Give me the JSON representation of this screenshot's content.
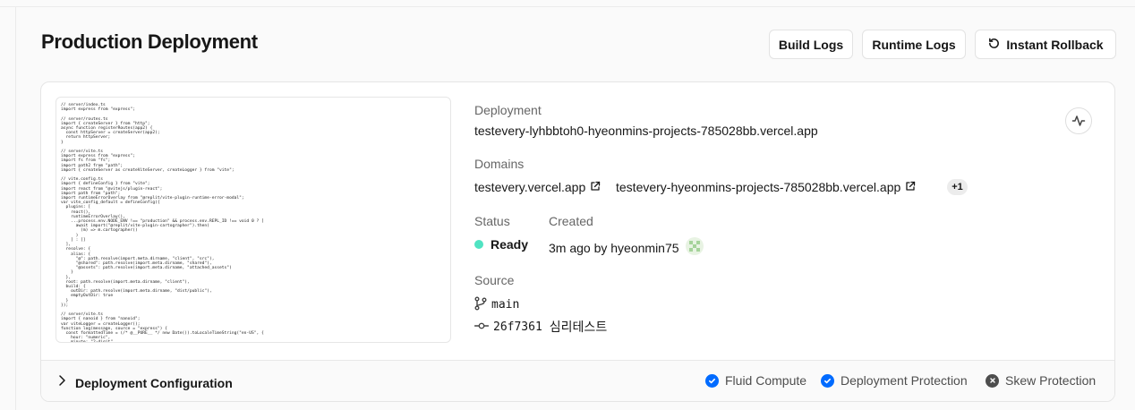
{
  "header": {
    "title": "Production Deployment",
    "buttons": {
      "build_logs": "Build Logs",
      "runtime_logs": "Runtime Logs",
      "instant_rollback": "Instant Rollback"
    }
  },
  "preview": {
    "code": "// server/index.ts\nimport express from \"express\";\n\n// server/routes.ts\nimport { createServer } from \"http\";\nasync function registerRoutes(app2) {\n  const httpServer = createServer(app2);\n  return httpServer;\n}\n\n// server/vite.ts\nimport express from \"express\";\nimport fs from \"fs\";\nimport path2 from \"path\";\nimport { createServer as createViteServer, createLogger } from \"vite\";\n\n// vite.config.ts\nimport { defineConfig } from \"vite\";\nimport react from \"@vitejs/plugin-react\";\nimport path from \"path\";\nimport runtimeErrorOverlay from \"@replit/vite-plugin-runtime-error-modal\";\nvar vite_config_default = defineConfig({\n  plugins: [\n    react(),\n    runtimeErrorOverlay(),\n    ...process.env.NODE_ENV !== \"production\" && process.env.REPL_ID !== void 0 ? [\n      await import(\"@replit/vite-plugin-cartographer\").then(\n        (m) => m.cartographer()\n      )\n    ] : []\n  ],\n  resolve: {\n    alias: {\n      \"@\": path.resolve(import.meta.dirname, \"client\", \"src\"),\n      \"@shared\": path.resolve(import.meta.dirname, \"shared\"),\n      \"@assets\": path.resolve(import.meta.dirname, \"attached_assets\")\n    }\n  },\n  root: path.resolve(import.meta.dirname, \"client\"),\n  build: {\n    outDir: path.resolve(import.meta.dirname, \"dist/public\"),\n    emptyOutDir: true\n  }\n});\n\n// server/vite.ts\nimport { nanoid } from \"nanoid\";\nvar viteLogger = createLogger();\nfunction log(message, source = \"express\") {\n  const formattedTime = (/* @__PURE__ */ new Date()).toLocaleTimeString(\"en-US\", {\n    hour: \"numeric\",\n    minute: \"2-digit\",\n    second: \"2-digit\","
  },
  "deployment": {
    "label": "Deployment",
    "url": "testevery-lyhbbtoh0-hyeonmins-projects-785028bb.vercel.app"
  },
  "domains": {
    "label": "Domains",
    "items": [
      "testevery.vercel.app",
      "testevery-hyeonmins-projects-785028bb.vercel.app"
    ],
    "extra_count": "+1"
  },
  "status": {
    "label": "Status",
    "value": "Ready",
    "color": "#50e3c2"
  },
  "created": {
    "label": "Created",
    "value": "3m ago by hyeonmin75"
  },
  "source": {
    "label": "Source",
    "branch": "main",
    "commit_hash": "26f7361",
    "commit_message": "심리테스트"
  },
  "footer": {
    "config_label": "Deployment Configuration",
    "features": [
      {
        "label": "Fluid Compute",
        "enabled": true
      },
      {
        "label": "Deployment Protection",
        "enabled": true
      },
      {
        "label": "Skew Protection",
        "enabled": false
      }
    ]
  },
  "icons": {
    "rollback": "rotate-ccw-icon",
    "activity": "pulse-icon",
    "external": "external-link-icon",
    "branch": "git-branch-icon",
    "commit": "git-commit-icon",
    "chevron": "chevron-right-icon",
    "check": "check-circle-icon",
    "disabled": "x-circle-icon",
    "avatar": "avatar-icon"
  },
  "colors": {
    "accent_blue": "#006bff",
    "disabled_gray": "#4d4d4d",
    "ready_green": "#50e3c2"
  }
}
